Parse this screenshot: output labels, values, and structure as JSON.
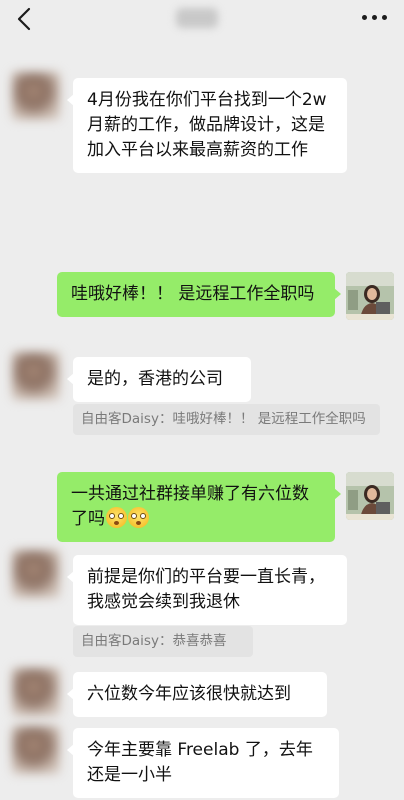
{
  "header": {
    "back_icon": "chevron-left-icon",
    "more_icon": "more-dots-icon"
  },
  "messages": [
    {
      "side": "in",
      "text": "4月份我在你们平台找到一个2w月薪的工作，做品牌设计，这是加入平台以来最高薪资的工作"
    },
    {
      "side": "out",
      "text": "哇哦好棒！！ 是远程工作全职吗"
    },
    {
      "side": "in",
      "text": "是的，香港的公司",
      "quote": "自由客Daisy：哇哦好棒！！ 是远程工作全职吗"
    },
    {
      "side": "out",
      "text": "一共通过社群接单赚了有六位数了吗",
      "emoji_count": 2
    },
    {
      "side": "in",
      "text": "前提是你们的平台要一直长青，我感觉会续到我退休",
      "quote": "自由客Daisy：恭喜恭喜"
    },
    {
      "side": "in",
      "text": "六位数今年应该很快就达到"
    },
    {
      "side": "in",
      "text": "今年主要靠 Freelab 了，去年还是一小半"
    }
  ],
  "colors": {
    "background": "#ededed",
    "bubble_in": "#ffffff",
    "bubble_out": "#95ec69",
    "quote_bg": "#e3e3e3",
    "quote_text": "#7a7a7a"
  }
}
